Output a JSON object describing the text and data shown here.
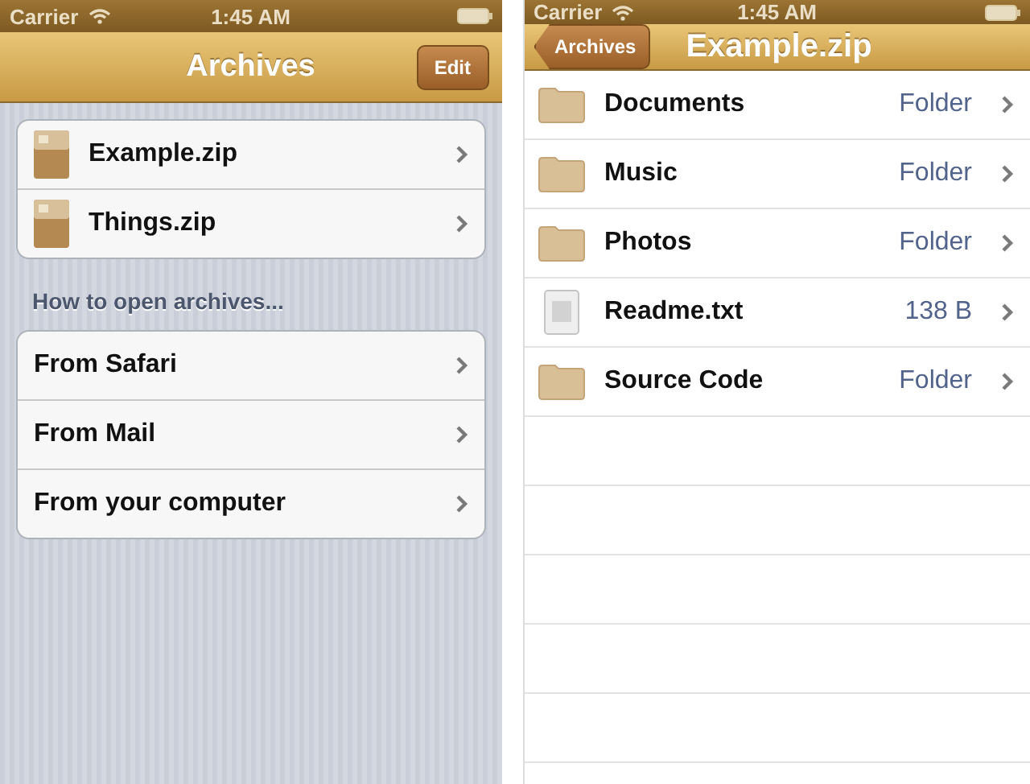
{
  "left_screen": {
    "status_bar": {
      "carrier": "Carrier",
      "time": "1:45 AM"
    },
    "nav_bar": {
      "title": "Archives",
      "edit_button": "Edit"
    },
    "archives": [
      {
        "name": "Example.zip"
      },
      {
        "name": "Things.zip"
      }
    ],
    "section_header": "How to open archives...",
    "help_items": [
      {
        "label": "From Safari"
      },
      {
        "label": "From Mail"
      },
      {
        "label": "From your computer"
      }
    ]
  },
  "right_screen": {
    "status_bar": {
      "carrier": "Carrier",
      "time": "1:45 AM"
    },
    "nav_bar": {
      "back_button": "Archives",
      "title": "Example.zip"
    },
    "files": [
      {
        "name": "Documents",
        "detail": "Folder",
        "kind": "folder"
      },
      {
        "name": "Music",
        "detail": "Folder",
        "kind": "folder"
      },
      {
        "name": "Photos",
        "detail": "Folder",
        "kind": "folder"
      },
      {
        "name": "Readme.txt",
        "detail": "138 B",
        "kind": "file"
      },
      {
        "name": "Source Code",
        "detail": "Folder",
        "kind": "folder"
      }
    ]
  }
}
